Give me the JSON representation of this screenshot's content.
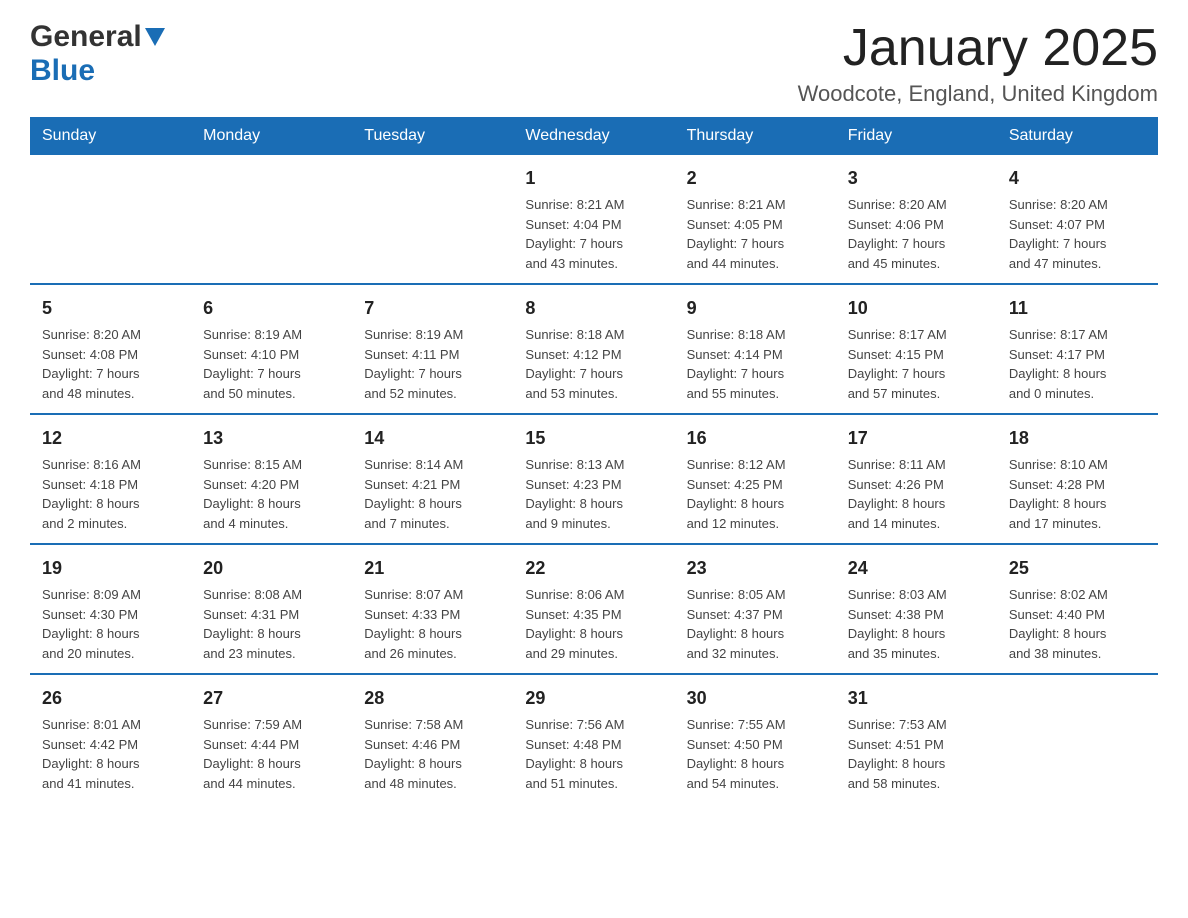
{
  "header": {
    "logo_general": "General",
    "logo_blue": "Blue",
    "title": "January 2025",
    "subtitle": "Woodcote, England, United Kingdom"
  },
  "columns": [
    "Sunday",
    "Monday",
    "Tuesday",
    "Wednesday",
    "Thursday",
    "Friday",
    "Saturday"
  ],
  "weeks": [
    [
      {
        "day": "",
        "info": ""
      },
      {
        "day": "",
        "info": ""
      },
      {
        "day": "",
        "info": ""
      },
      {
        "day": "1",
        "info": "Sunrise: 8:21 AM\nSunset: 4:04 PM\nDaylight: 7 hours\nand 43 minutes."
      },
      {
        "day": "2",
        "info": "Sunrise: 8:21 AM\nSunset: 4:05 PM\nDaylight: 7 hours\nand 44 minutes."
      },
      {
        "day": "3",
        "info": "Sunrise: 8:20 AM\nSunset: 4:06 PM\nDaylight: 7 hours\nand 45 minutes."
      },
      {
        "day": "4",
        "info": "Sunrise: 8:20 AM\nSunset: 4:07 PM\nDaylight: 7 hours\nand 47 minutes."
      }
    ],
    [
      {
        "day": "5",
        "info": "Sunrise: 8:20 AM\nSunset: 4:08 PM\nDaylight: 7 hours\nand 48 minutes."
      },
      {
        "day": "6",
        "info": "Sunrise: 8:19 AM\nSunset: 4:10 PM\nDaylight: 7 hours\nand 50 minutes."
      },
      {
        "day": "7",
        "info": "Sunrise: 8:19 AM\nSunset: 4:11 PM\nDaylight: 7 hours\nand 52 minutes."
      },
      {
        "day": "8",
        "info": "Sunrise: 8:18 AM\nSunset: 4:12 PM\nDaylight: 7 hours\nand 53 minutes."
      },
      {
        "day": "9",
        "info": "Sunrise: 8:18 AM\nSunset: 4:14 PM\nDaylight: 7 hours\nand 55 minutes."
      },
      {
        "day": "10",
        "info": "Sunrise: 8:17 AM\nSunset: 4:15 PM\nDaylight: 7 hours\nand 57 minutes."
      },
      {
        "day": "11",
        "info": "Sunrise: 8:17 AM\nSunset: 4:17 PM\nDaylight: 8 hours\nand 0 minutes."
      }
    ],
    [
      {
        "day": "12",
        "info": "Sunrise: 8:16 AM\nSunset: 4:18 PM\nDaylight: 8 hours\nand 2 minutes."
      },
      {
        "day": "13",
        "info": "Sunrise: 8:15 AM\nSunset: 4:20 PM\nDaylight: 8 hours\nand 4 minutes."
      },
      {
        "day": "14",
        "info": "Sunrise: 8:14 AM\nSunset: 4:21 PM\nDaylight: 8 hours\nand 7 minutes."
      },
      {
        "day": "15",
        "info": "Sunrise: 8:13 AM\nSunset: 4:23 PM\nDaylight: 8 hours\nand 9 minutes."
      },
      {
        "day": "16",
        "info": "Sunrise: 8:12 AM\nSunset: 4:25 PM\nDaylight: 8 hours\nand 12 minutes."
      },
      {
        "day": "17",
        "info": "Sunrise: 8:11 AM\nSunset: 4:26 PM\nDaylight: 8 hours\nand 14 minutes."
      },
      {
        "day": "18",
        "info": "Sunrise: 8:10 AM\nSunset: 4:28 PM\nDaylight: 8 hours\nand 17 minutes."
      }
    ],
    [
      {
        "day": "19",
        "info": "Sunrise: 8:09 AM\nSunset: 4:30 PM\nDaylight: 8 hours\nand 20 minutes."
      },
      {
        "day": "20",
        "info": "Sunrise: 8:08 AM\nSunset: 4:31 PM\nDaylight: 8 hours\nand 23 minutes."
      },
      {
        "day": "21",
        "info": "Sunrise: 8:07 AM\nSunset: 4:33 PM\nDaylight: 8 hours\nand 26 minutes."
      },
      {
        "day": "22",
        "info": "Sunrise: 8:06 AM\nSunset: 4:35 PM\nDaylight: 8 hours\nand 29 minutes."
      },
      {
        "day": "23",
        "info": "Sunrise: 8:05 AM\nSunset: 4:37 PM\nDaylight: 8 hours\nand 32 minutes."
      },
      {
        "day": "24",
        "info": "Sunrise: 8:03 AM\nSunset: 4:38 PM\nDaylight: 8 hours\nand 35 minutes."
      },
      {
        "day": "25",
        "info": "Sunrise: 8:02 AM\nSunset: 4:40 PM\nDaylight: 8 hours\nand 38 minutes."
      }
    ],
    [
      {
        "day": "26",
        "info": "Sunrise: 8:01 AM\nSunset: 4:42 PM\nDaylight: 8 hours\nand 41 minutes."
      },
      {
        "day": "27",
        "info": "Sunrise: 7:59 AM\nSunset: 4:44 PM\nDaylight: 8 hours\nand 44 minutes."
      },
      {
        "day": "28",
        "info": "Sunrise: 7:58 AM\nSunset: 4:46 PM\nDaylight: 8 hours\nand 48 minutes."
      },
      {
        "day": "29",
        "info": "Sunrise: 7:56 AM\nSunset: 4:48 PM\nDaylight: 8 hours\nand 51 minutes."
      },
      {
        "day": "30",
        "info": "Sunrise: 7:55 AM\nSunset: 4:50 PM\nDaylight: 8 hours\nand 54 minutes."
      },
      {
        "day": "31",
        "info": "Sunrise: 7:53 AM\nSunset: 4:51 PM\nDaylight: 8 hours\nand 58 minutes."
      },
      {
        "day": "",
        "info": ""
      }
    ]
  ]
}
